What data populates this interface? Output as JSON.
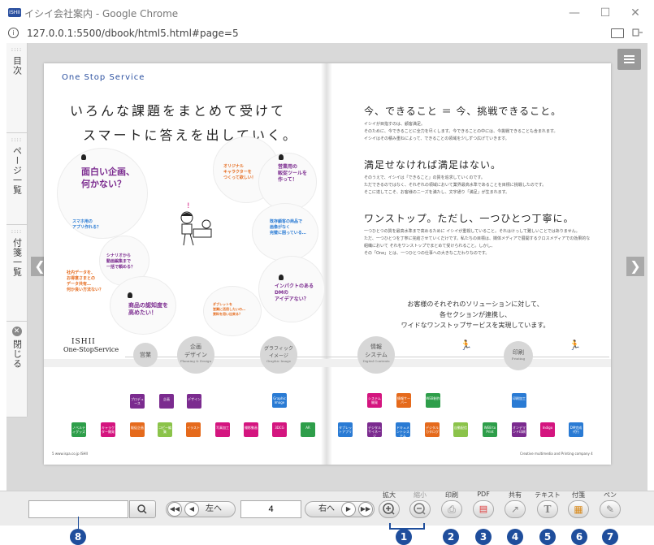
{
  "window": {
    "title": "イシイ会社案内 - Google Chrome",
    "app_icon_text": "ISHII",
    "minimize": "—",
    "maximize": "☐",
    "close": "✕"
  },
  "address": {
    "url": "127.0.0.1:5500/dbook/html5.html#page=5",
    "info_glyph": "i"
  },
  "sidebar": {
    "tabs": [
      {
        "label": "目次"
      },
      {
        "label": "ページ一覧"
      },
      {
        "label": "付箋一覧"
      },
      {
        "label": "閉じる"
      }
    ]
  },
  "book": {
    "left": {
      "section_label": "One Stop Service",
      "headline_line1": "いろんな課題をまとめて受けて",
      "headline_line2": "スマートに答えを出していく。",
      "bubbles": {
        "b1": "面白い企画、\n何かない？",
        "b2": "スマホ用の\nアプリ作れる？",
        "b3": "オリジナル\nキャラクターを\nつくって欲しい！",
        "b4": "営業用の\n販促ツールを\n作って！",
        "b5": "既存顧客の商品で\n画像がなく\n完璧に困っている…",
        "b6": "シナリオから\n動画編集まで\n一括で頼める？",
        "b7": "社内データを、\nお得意さまとの\nデータ共有…\n何か良い方法ない？",
        "b8": "インパクトのある\nDMの\nアイデアない？",
        "b9": "商品の認知度を\n高めたい！",
        "b10": "ダブレットを\n営業に活用したいの…\n資料を用い出来る？"
      },
      "company": "ISHII",
      "company_sub": "One-StopService",
      "footer": "www.ispa.co.jp  ISHII",
      "page_no": "5"
    },
    "stages": [
      {
        "label": "営業",
        "sub": ""
      },
      {
        "label": "企画\nデザイン",
        "sub": "Planning & Design"
      },
      {
        "label": "グラフィック\nイメージ",
        "sub": "Graphic Image"
      },
      {
        "label": "情報\nシステム",
        "sub": "Digital Contents"
      },
      {
        "label": "印刷",
        "sub": "Printing"
      }
    ],
    "services_top": [
      "プロデュース",
      "企画",
      "デザイン",
      "Graphic Image"
    ],
    "services_bottom_left": [
      "ノベルティグッズ",
      "キャラクター開発",
      "販促企画",
      "コピー編集",
      "イラスト",
      "写真加工",
      "撮影動画",
      "3DCG",
      "AR"
    ],
    "services_top_right": [
      "システム開発",
      "情報サーバー",
      "WEB制作",
      "印刷加工"
    ],
    "services_bottom_right": [
      "タブレットアプリ",
      "デジタルサイネージ",
      "ドキュメントシステム",
      "デジタルカタログ",
      "自動配信",
      "WEB to Print",
      "オンデマンド印刷",
      "Indigo",
      "DM完成代行"
    ],
    "right": {
      "h1": "今、できること ＝ 今、挑戦できること。",
      "p1": "イシイが目指すのは、顧客満足。\nそのために、今できることに全力を尽くします。今できることの中には、今挑戦できることも含まれます。\nイシイはその積み重ねによって、できることの領域を少しずつ広げていきます。",
      "h2": "満足せなければ満足はない。",
      "p2": "そのうえで、イシイは「できること」の質を追求していくのです。\nただできるのではなく、それぞれの領域において業界最高水準であることを目標に挑戦したのです。\nそこに達してこそ、お客様のニーズを満たし、文字通り「満足」が生まれます。",
      "h3": "ワンストップ。ただし、一つひとつ丁寧に。",
      "p3": "一つひとつの質を最高水準まで高めるために イシイが重視していること。それはけっして難しいことではありません。\nただ、一つひとつを丁寧に完結させていくだけです。私たちの目標は、媒体メディアで展開するクロスメディアでの効果的な組織において それをワンストップでまとめて受けられること。しかし、\nその「One」とは、一つひとつの仕事への大きなこだわりなのです。",
      "summary": "お客様のそれぞれのソリューションに対して、\n各セクションが連携し、\nワイドなワンストップサービスを実現しています。",
      "footer": "Creative multimedia and Printing company",
      "page_no": "4"
    }
  },
  "toolbar": {
    "search_placeholder": "",
    "prev_label": "左へ",
    "next_label": "右へ",
    "page_value": "4",
    "zoom_in_label": "拡大",
    "zoom_out_label": "縮小",
    "print_label": "印刷",
    "pdf_label": "PDF",
    "share_label": "共有",
    "text_label": "テキスト",
    "sticky_label": "付箋",
    "pen_label": "ペン"
  },
  "callouts": [
    "1",
    "2",
    "3",
    "4",
    "5",
    "6",
    "7",
    "8"
  ],
  "colors": {
    "accent": "#1f4e9c",
    "purple": "#7b2b8f",
    "magenta": "#d4157f",
    "orange": "#e56a1c",
    "green": "#2e9e4a",
    "blue": "#2a7bd4"
  }
}
